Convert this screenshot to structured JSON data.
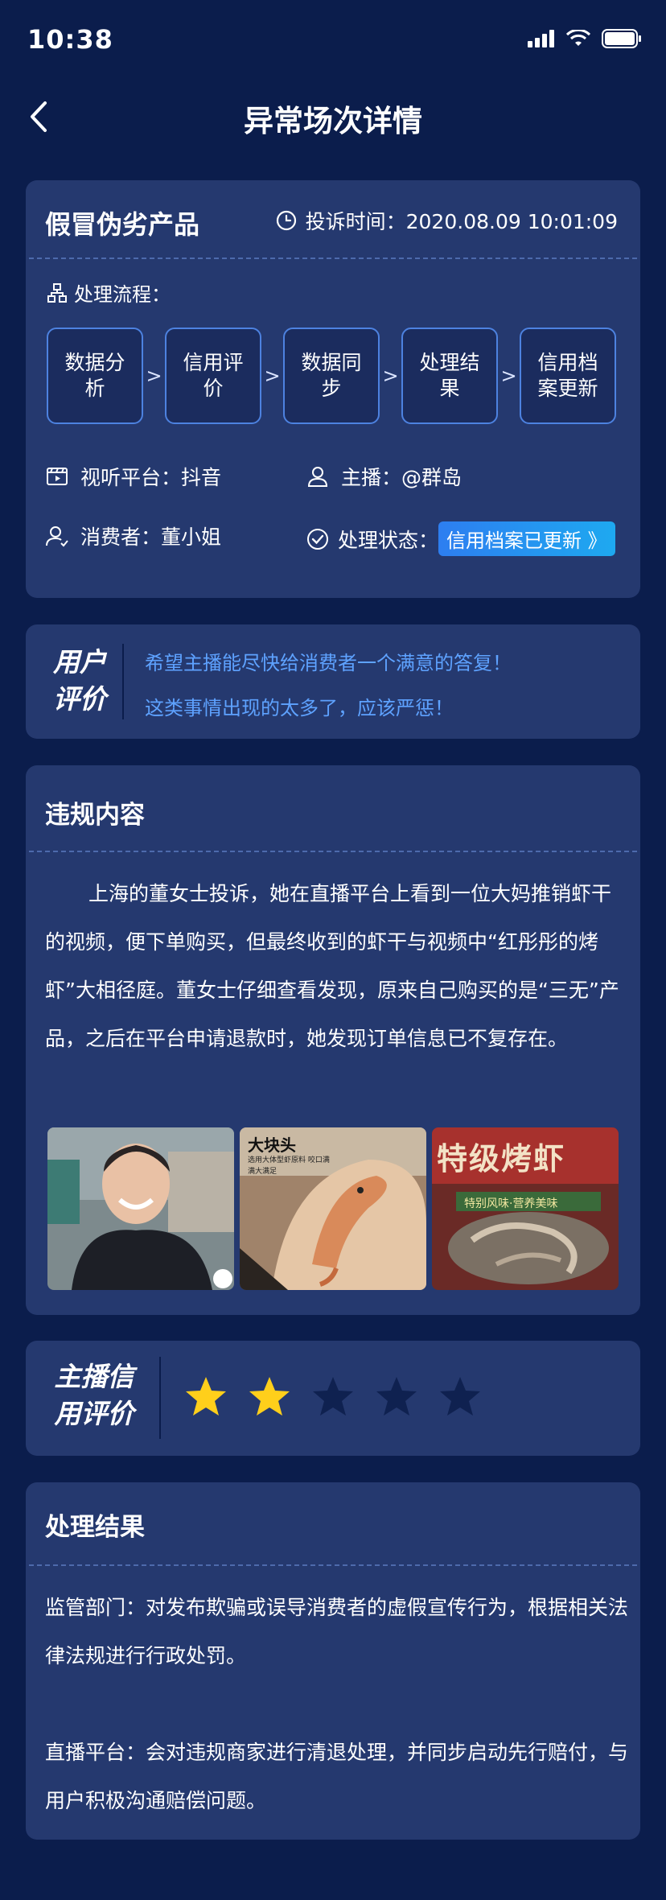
{
  "status_bar": {
    "time": "10:38"
  },
  "nav": {
    "title": "异常场次详情"
  },
  "case": {
    "title": "假冒伪劣产品",
    "complaint_time_label": "投诉时间：2020.08.09  10:01:09",
    "flow_label": "处理流程：",
    "flow_steps": [
      {
        "label": "数据分析"
      },
      {
        "label": "信用评价"
      },
      {
        "label": "数据同步"
      },
      {
        "label": "处理结果"
      },
      {
        "label": "信用档案更新"
      }
    ],
    "flow_separator": ">",
    "platform": "视听平台：抖音",
    "anchor": "主播：@群岛",
    "consumer": "消费者：董小姐",
    "status_label": "处理状态：",
    "status_value": "信用档案已更新 》"
  },
  "user_review": {
    "title_line1": "用户",
    "title_line2": "评价",
    "comments": [
      {
        "text": "希望主播能尽快给消费者一个满意的答复！"
      },
      {
        "text": "这类事情出现的太多了，应该严惩！"
      }
    ]
  },
  "violation": {
    "title": "违规内容",
    "content": "上海的董女士投诉，她在直播平台上看到一位大妈推销虾干的视频，便下单购买，但最终收到的虾干与视频中“红彤彤的烤虾”大相径庭。董女士仔细查看发现，原来自己购买的是“三无”产品，之后在平台申请退款时，她发现订单信息已不复存在。",
    "image2_caption": "大块头",
    "image2_subcaption": "选用大体型虾原料 咬口满满大满足",
    "image3_caption": "特级烤虾",
    "image3_subcaption": "特别风味·营养美味"
  },
  "credit_rating": {
    "title_line1": "主播信",
    "title_line2": "用评价",
    "rating": 2,
    "max": 5,
    "filled_color": "#ffcf1b",
    "empty_color": "#0f2150"
  },
  "result": {
    "title": "处理结果",
    "regulator": "监管部门：对发布欺骗或误导消费者的虚假宣传行为，根据相关法律法规进行行政处罚。",
    "platform": "直播平台：会对违规商家进行清退处理，并同步启动先行赔付，与用户积极沟通赔偿问题。"
  }
}
